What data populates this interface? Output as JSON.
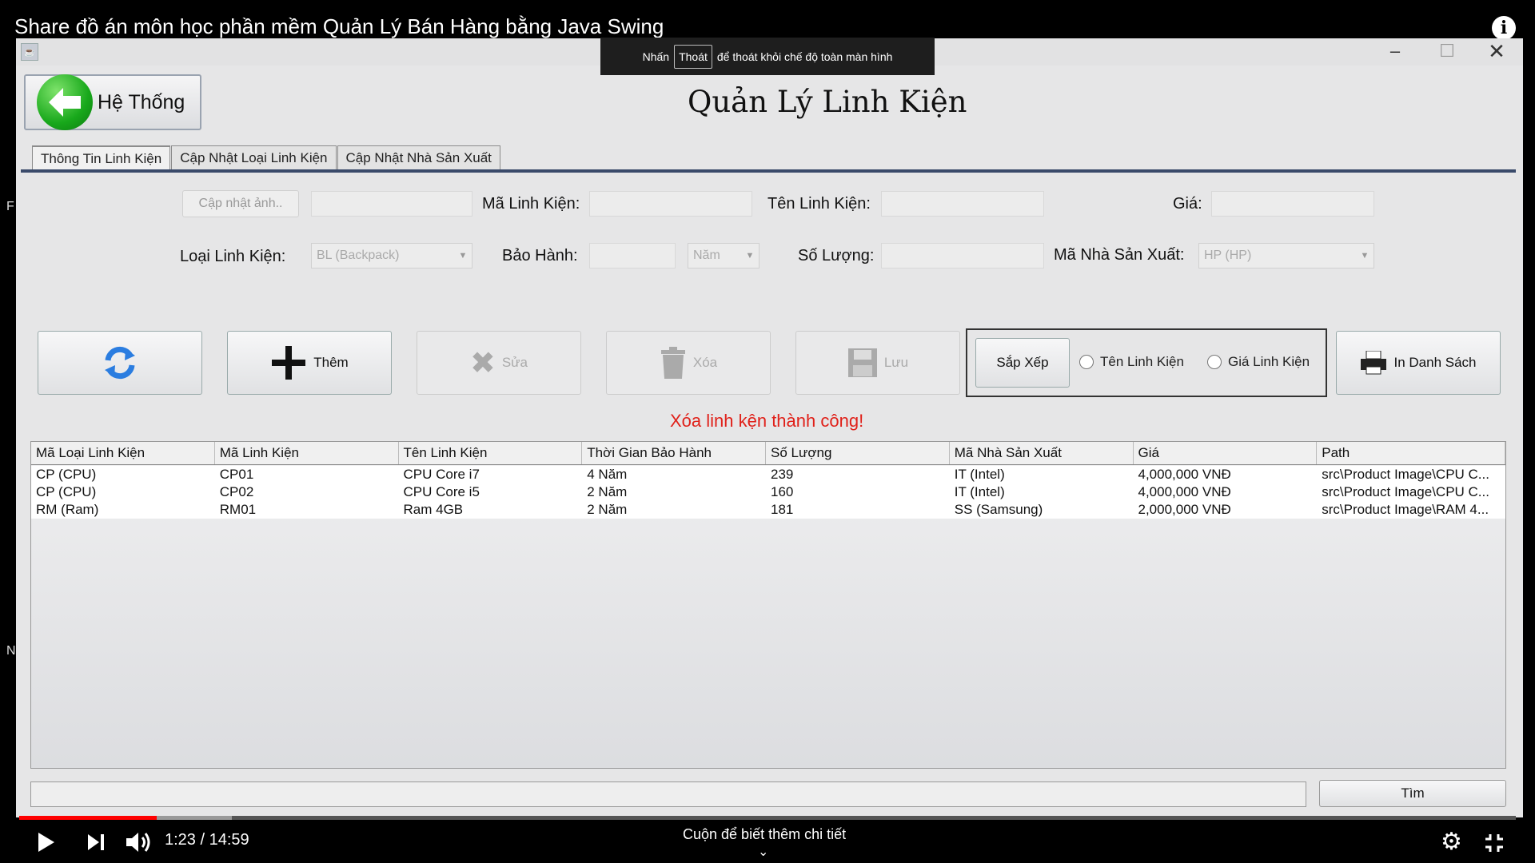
{
  "player": {
    "video_title": "Share đồ án môn học phần mềm Quản Lý Bán Hàng bằng Java Swing",
    "toast_before": "Nhấn",
    "toast_key": "Thoát",
    "toast_after": "để thoát khỏi chế độ toàn màn hình",
    "time": "1:23 / 14:59",
    "progress_fraction": 0.092,
    "scroll_hint": "Cuộn để biết thêm chi tiết"
  },
  "app": {
    "back_label": "Hệ Thống",
    "title": "Quản Lý Linh Kiện",
    "tabs": [
      "Thông Tin Linh Kiện",
      "Cập Nhật Loại Linh Kiện",
      "Cập Nhật Nhà Sản Xuất"
    ],
    "form": {
      "update_image": "Cập nhật ảnh..",
      "ma_linh_kien": "Mã Linh Kiện:",
      "ten_linh_kien": "Tên Linh Kiện:",
      "gia": "Giá:",
      "loai_linh_kien": "Loại Linh Kiện:",
      "loai_value": "BL (Backpack)",
      "bao_hanh": "Bảo Hành:",
      "bao_hanh_unit": "Năm",
      "so_luong": "Số Lượng:",
      "ma_nsx": "Mã Nhà Sản Xuất:",
      "nsx_value": "HP (HP)"
    },
    "toolbar": {
      "add": "Thêm",
      "edit": "Sửa",
      "delete": "Xóa",
      "save": "Lưu",
      "sort": "Sắp Xếp",
      "sort_name": "Tên Linh Kiện",
      "sort_price": "Giá Linh Kiện",
      "print": "In Danh Sách"
    },
    "status": "Xóa linh kện thành công!",
    "table": {
      "headers": [
        "Mã Loại Linh Kiện",
        "Mã Linh Kiện",
        "Tên Linh Kiện",
        "Thời Gian Bảo Hành",
        "Số Lượng",
        "Mã Nhà Sản Xuất",
        "Giá",
        "Path"
      ],
      "rows": [
        [
          "CP (CPU)",
          "CP01",
          "CPU Core i7",
          "4 Năm",
          "239",
          "IT (Intel)",
          "4,000,000 VNĐ",
          "src\\Product Image\\CPU C..."
        ],
        [
          "CP (CPU)",
          "CP02",
          "CPU Core i5",
          "2 Năm",
          "160",
          "IT (Intel)",
          "4,000,000 VNĐ",
          "src\\Product Image\\CPU C..."
        ],
        [
          "RM (Ram)",
          "RM01",
          "Ram 4GB",
          "2 Năm",
          "181",
          "SS (Samsung)",
          "2,000,000 VNĐ",
          "src\\Product Image\\RAM 4..."
        ]
      ]
    },
    "search_button": "Tìm"
  },
  "colors": {
    "accent_red": "#e0211a",
    "progress_red": "#ff0000",
    "tab_line": "#3a4a6a"
  }
}
